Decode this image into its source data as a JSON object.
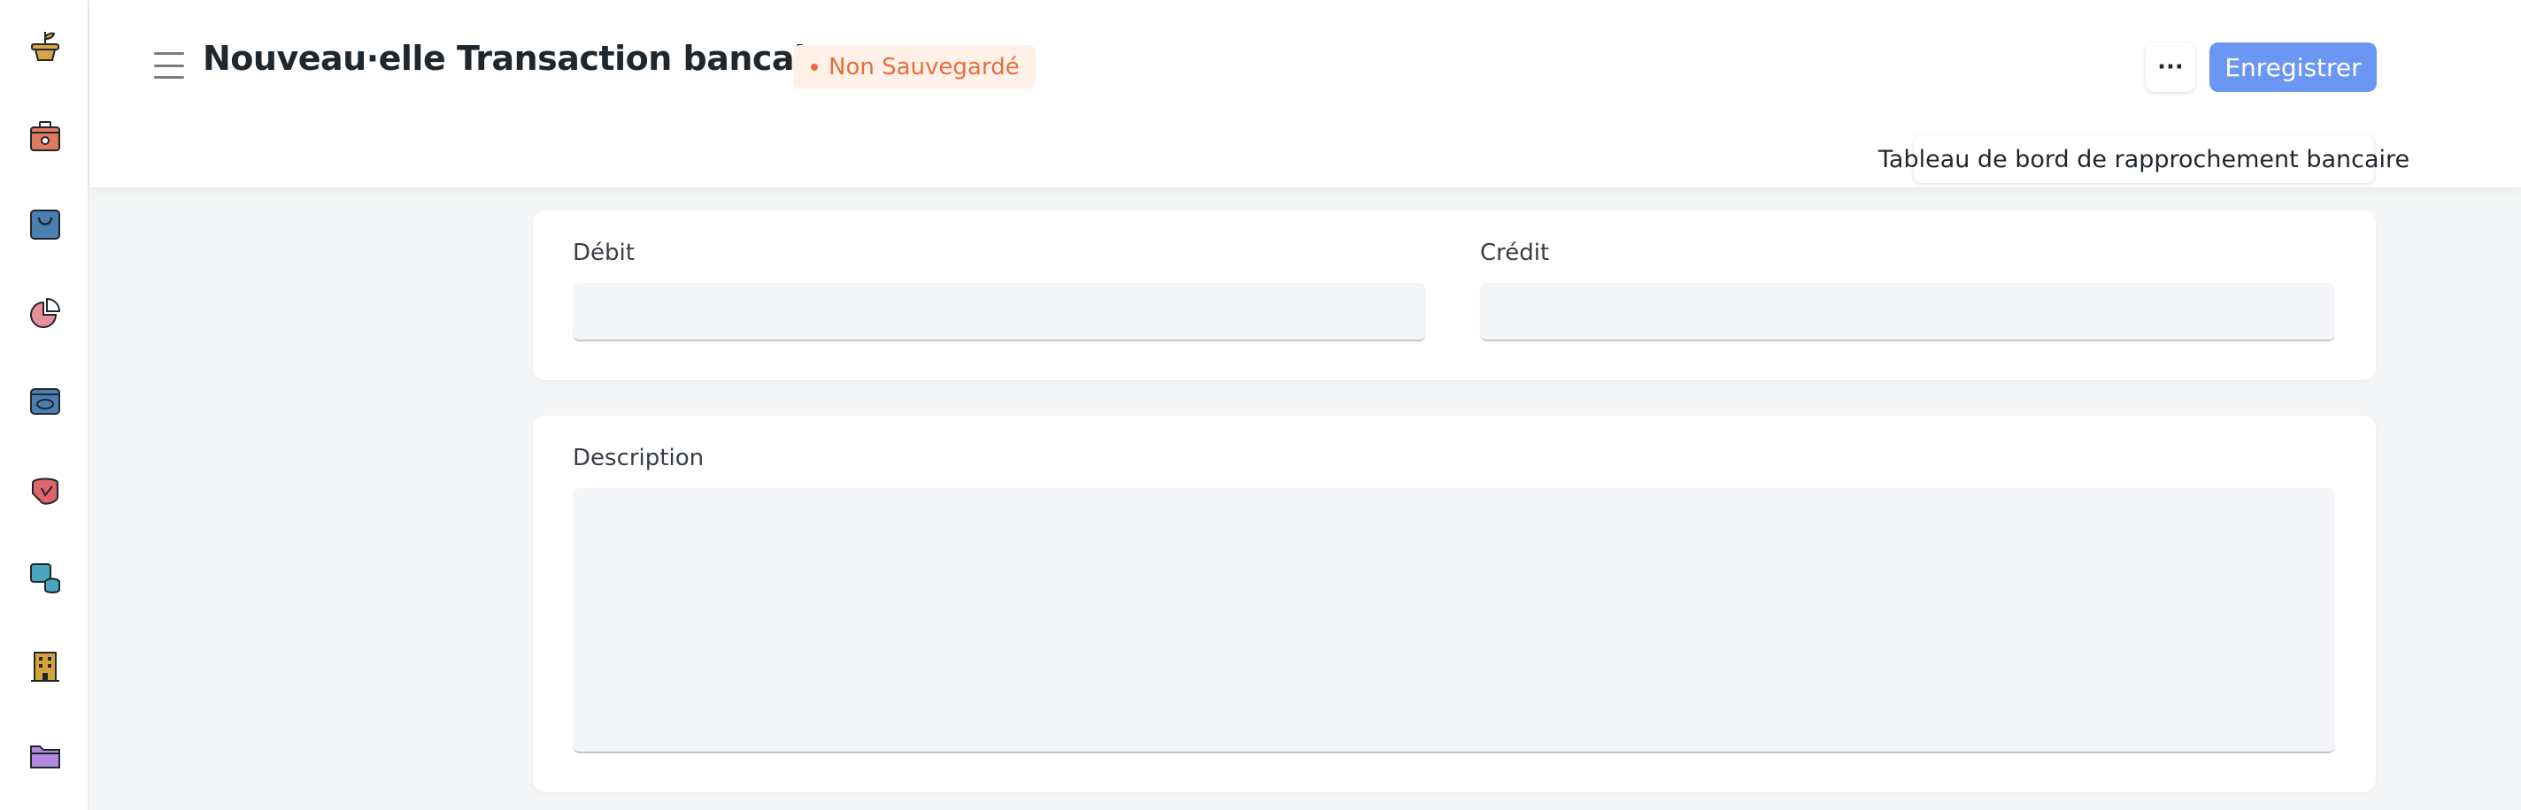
{
  "sidebar": {
    "items": [
      {
        "icon": "plant-pot-icon",
        "color": "#d9a441"
      },
      {
        "icon": "cash-register-icon",
        "color": "#e07a5f"
      },
      {
        "icon": "shopping-bag-icon",
        "color": "#4a7fb0"
      },
      {
        "icon": "pie-chart-icon",
        "color": "#e8909a"
      },
      {
        "icon": "wallet-icon",
        "color": "#4a7fb0"
      },
      {
        "icon": "money-hand-icon",
        "color": "#e0646a"
      },
      {
        "icon": "coins-stack-icon",
        "color": "#4aa6bf"
      },
      {
        "icon": "office-building-icon",
        "color": "#d4a23a"
      },
      {
        "icon": "folder-icon",
        "color": "#b48ae0"
      }
    ]
  },
  "header": {
    "title": "Nouveau·elle Transaction bancaire",
    "status_badge": "Non Sauvegardé",
    "more_label": "···",
    "save_label": "Enregistrer",
    "dashboard_link": "Tableau de bord de rapprochement bancaire"
  },
  "form": {
    "debit_label": "Débit",
    "debit_value": "",
    "credit_label": "Crédit",
    "credit_value": "",
    "description_label": "Description",
    "description_value": ""
  },
  "colors": {
    "primary": "#6b96f4",
    "badge_text": "#e86c3d",
    "badge_bg": "#fff1e7"
  }
}
